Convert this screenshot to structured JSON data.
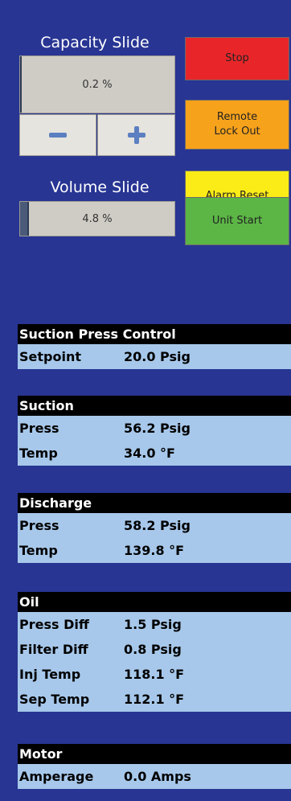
{
  "capacity_slide": {
    "title": "Capacity Slide",
    "value": "0.2 %",
    "level_percent": 0.2
  },
  "volume_slide": {
    "title": "Volume Slide",
    "value": "4.8 %",
    "level_percent": 4.8
  },
  "buttons": {
    "stop": {
      "label": "Stop",
      "color": "#e8262a"
    },
    "remote_lockout": {
      "label_line1": "Remote",
      "label_line2": "Lock Out",
      "color": "#f7a21b"
    },
    "alarm_reset": {
      "label": "Alarm Reset",
      "color": "#fbec17"
    },
    "unit_start": {
      "label": "Unit Start",
      "color": "#5cb646"
    }
  },
  "icons": {
    "minus": "minus-icon",
    "plus": "plus-icon"
  },
  "sections": {
    "suction_press_control": {
      "title": "Suction Press Control",
      "rows": [
        {
          "label": "Setpoint",
          "value": "20.0 Psig"
        }
      ]
    },
    "suction": {
      "title": "Suction",
      "rows": [
        {
          "label": "Press",
          "value": "56.2 Psig"
        },
        {
          "label": "Temp",
          "value": "34.0 °F"
        }
      ]
    },
    "discharge": {
      "title": "Discharge",
      "rows": [
        {
          "label": "Press",
          "value": "58.2 Psig"
        },
        {
          "label": "Temp",
          "value": "139.8 °F"
        }
      ]
    },
    "oil": {
      "title": "Oil",
      "rows": [
        {
          "label": "Press Diff",
          "value": "1.5 Psig"
        },
        {
          "label": "Filter Diff",
          "value": "0.8 Psig"
        },
        {
          "label": "Inj Temp",
          "value": "118.1 °F"
        },
        {
          "label": "Sep Temp",
          "value": "112.1 °F"
        }
      ]
    },
    "motor": {
      "title": "Motor",
      "rows": [
        {
          "label": "Amperage",
          "value": "0.0 Amps"
        }
      ]
    }
  }
}
